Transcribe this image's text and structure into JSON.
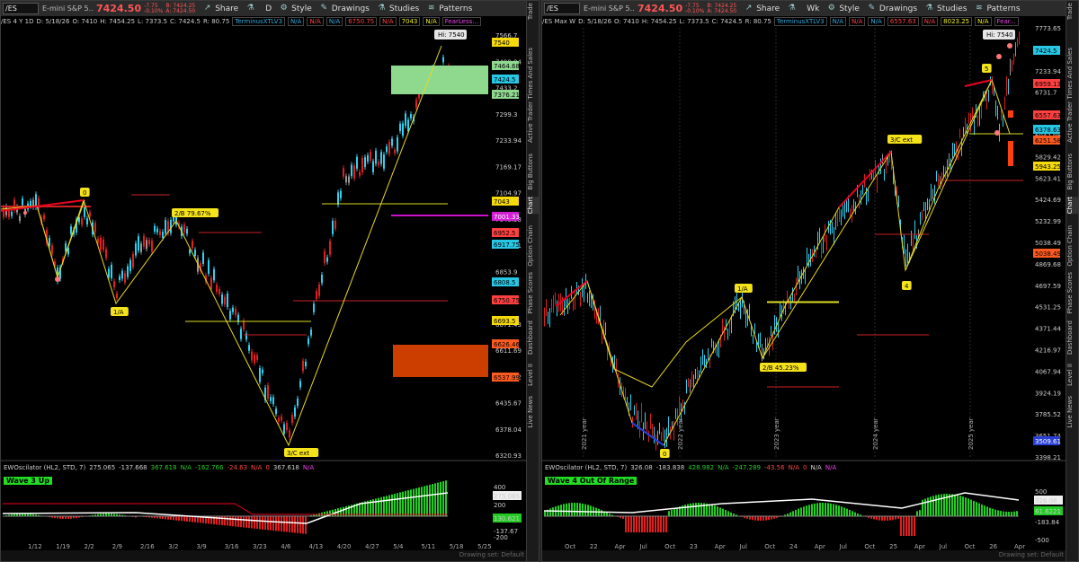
{
  "left": {
    "toolbar": {
      "symbol": "/ES",
      "description": "E-mini S&P 5...",
      "price": "7424.50",
      "change_line1": "-7.75",
      "change_line2": "-0.10%",
      "bid": "B: 7424.25",
      "ask": "A: 7424.50",
      "style": "Style",
      "drawings": "Drawings",
      "studies": "Studies",
      "patterns": "Patterns",
      "share": "Share",
      "timeframe": "D"
    },
    "info": {
      "title": "/ES 4 Y 1D",
      "date": "D: 5/18/26",
      "open": "O: 7410",
      "high": "H: 7454.25",
      "low": "L: 7373.5",
      "close": "C: 7424.5",
      "range": "R: 80.75",
      "study": "TerminusXTLV3",
      "na": "N/A",
      "v1": "6750.75",
      "v2": "7043",
      "fear": "FearLess..."
    },
    "hi_label": "Hi: 7540",
    "price_axis": [
      "7566.7",
      "7498.94",
      "7433.2",
      "7299.3",
      "7233.94",
      "7169.17",
      "7104.97",
      "7040.93",
      "6978.31",
      "6853.9",
      "6731.7",
      "6671.43",
      "6611.69",
      "6493.82",
      "6435.67",
      "6378.04",
      "6320.93"
    ],
    "price_tags": [
      {
        "v": "7540",
        "c": "#f5d90a",
        "tc": "#000"
      },
      {
        "v": "7464.68",
        "c": "#8fd98f",
        "tc": "#000"
      },
      {
        "v": "7424.5",
        "c": "#27c7e6",
        "tc": "#000"
      },
      {
        "v": "7376.21",
        "c": "#8fd98f",
        "tc": "#000"
      },
      {
        "v": "7043",
        "c": "#f5d90a",
        "tc": "#000"
      },
      {
        "v": "7001.33",
        "c": "#d41fd4",
        "tc": "#fff"
      },
      {
        "v": "6952.5",
        "c": "#ff4040",
        "tc": "#000"
      },
      {
        "v": "6917.75",
        "c": "#27c7e6",
        "tc": "#000"
      },
      {
        "v": "6808.5",
        "c": "#27c7e6",
        "tc": "#000"
      },
      {
        "v": "6750.75",
        "c": "#ff4040",
        "tc": "#000"
      },
      {
        "v": "6693.5",
        "c": "#f5d90a",
        "tc": "#000"
      },
      {
        "v": "6626.46",
        "c": "#ff5a1f",
        "tc": "#000"
      },
      {
        "v": "6537.99",
        "c": "#ff5a1f",
        "tc": "#000"
      }
    ],
    "annotations": [
      "0",
      "2/B 79.67%",
      "1/A",
      "3/C ext"
    ],
    "osc": {
      "name": "EWOscilator (HL2, STD, 7)",
      "v1": "275.065",
      "v2": "-137.668",
      "v3": "367.618",
      "na": "N/A",
      "v4": "-162.766",
      "v5": "-24.63",
      "v6": "N/A",
      "v7": "0",
      "v8": "367.618",
      "v9": "N/A",
      "wave": "Wave 3 Up",
      "axis": [
        "400",
        "275.065",
        "200",
        "130.621",
        "-137.67",
        "-200"
      ]
    },
    "x_axis": [
      "1/12",
      "1/19",
      "2/2",
      "2/9",
      "2/16",
      "3/2",
      "3/9",
      "3/16",
      "3/23",
      "4/6",
      "4/13",
      "4/20",
      "4/27",
      "5/4",
      "5/11",
      "5/18",
      "5/25"
    ],
    "footer": "Drawing set: Default"
  },
  "right": {
    "toolbar": {
      "symbol": "/ES",
      "description": "E-mini S&P 5...",
      "price": "7424.50",
      "change_line1": "-7.75",
      "change_line2": "-0.10%",
      "bid": "B: 7424.25",
      "ask": "A: 7424.50",
      "style": "Style",
      "drawings": "Drawings",
      "studies": "Studies",
      "patterns": "Patterns",
      "share": "Share",
      "timeframe": "Wk"
    },
    "info": {
      "title": "/ES Max W",
      "date": "D: 5/18/26",
      "open": "O: 7410",
      "high": "H: 7454.25",
      "low": "L: 7373.5",
      "close": "C: 7424.5",
      "range": "R: 80.75",
      "study": "TerminusXTLV3",
      "na": "N/A",
      "v1": "6557.63",
      "v2": "8023.25",
      "fear": "Fear..."
    },
    "hi_label": "Hi: 7540",
    "price_axis": [
      "7773.65",
      "7498.94",
      "7233.94",
      "6731.7",
      "6493.82",
      "6042.95",
      "5829.42",
      "5623.41",
      "5424.69",
      "5232.99",
      "5038.49",
      "4869.68",
      "4697.59",
      "4531.25",
      "4371.44",
      "4216.97",
      "4067.94",
      "3924.19",
      "3785.52",
      "3651.74",
      "3398.21"
    ],
    "price_tags": [
      {
        "v": "7424.5",
        "c": "#27c7e6",
        "tc": "#000"
      },
      {
        "v": "6959.13",
        "c": "#ff4040",
        "tc": "#000"
      },
      {
        "v": "6557.63",
        "c": "#ff4040",
        "tc": "#000"
      },
      {
        "v": "6378.63",
        "c": "#27c7e6",
        "tc": "#000"
      },
      {
        "v": "6251.58",
        "c": "#ff5a1f",
        "tc": "#000"
      },
      {
        "v": "5943.25",
        "c": "#f5d90a",
        "tc": "#000"
      },
      {
        "v": "5038.49",
        "c": "#ff5a1f",
        "tc": "#000"
      },
      {
        "v": "3509.61",
        "c": "#2a3fd8",
        "tc": "#fff"
      }
    ],
    "annotations": [
      "5",
      "3/C ext",
      "1/A",
      "2/B 45.23%",
      "4",
      "0"
    ],
    "year_labels": [
      "2021 year",
      "2022 year",
      "2023 year",
      "2024 year",
      "2025 year"
    ],
    "osc": {
      "name": "EWOscilator (HL2, STD, 7)",
      "v1": "326.08",
      "v2": "-183.838",
      "v3": "428.982",
      "na": "N/A",
      "v4": "-247.289",
      "v5": "-43.56",
      "v6": "N/A",
      "v7": "0",
      "v8": "N/A",
      "v9": "N/A",
      "wave": "Wave 4  Out Of Range",
      "axis": [
        "500",
        "326.08",
        "61.6221",
        "-183.84",
        "-500"
      ]
    },
    "x_axis": [
      "Oct",
      "22",
      "Apr",
      "Jul",
      "Oct",
      "23",
      "Apr",
      "Jul",
      "Oct",
      "24",
      "Apr",
      "Jul",
      "Oct",
      "25",
      "Apr",
      "Jul",
      "Oct",
      "26",
      "Apr"
    ],
    "footer": "Drawing set: Default"
  },
  "side_tabs": [
    "Trade",
    "Times And Sales",
    "Active Trader",
    "Big Buttons",
    "Chart",
    "Option Chain",
    "Phase Scores",
    "Dashboard",
    "Level II",
    "Live News"
  ]
}
